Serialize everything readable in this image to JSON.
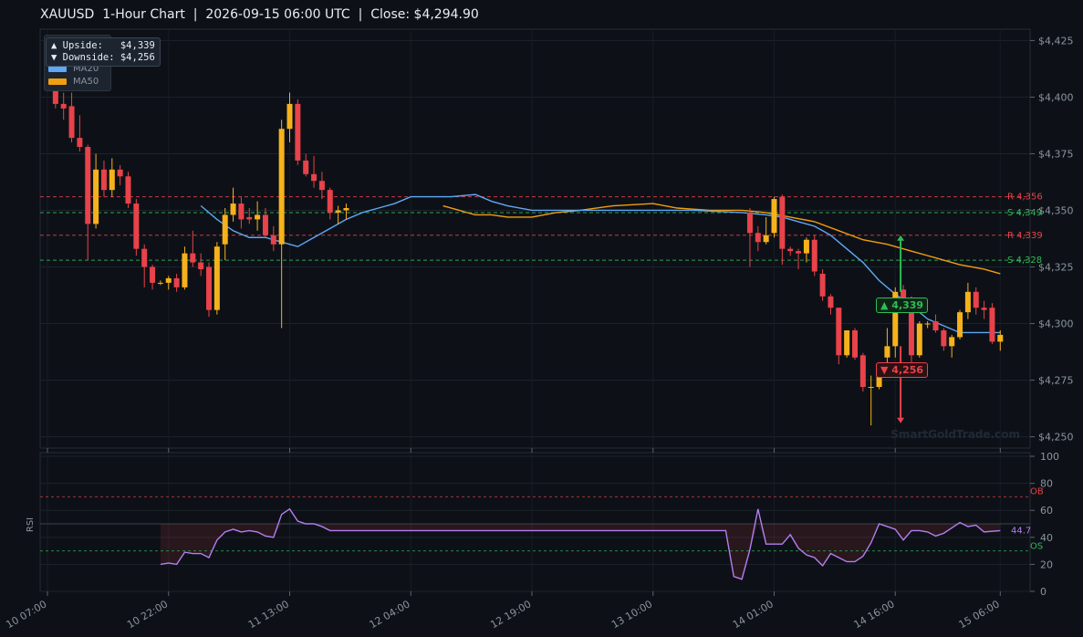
{
  "title": "XAUUSD  1-Hour Chart  |  2026-09-15 06:00 UTC  |  Close: $4,294.90",
  "annotation": {
    "upside": "▲ Upside:   $4,339",
    "downside": "▼ Downside: $4,256"
  },
  "watermark": "SmartGoldTrade.com",
  "colors": {
    "background": "#0d1117",
    "bull": "#f6b21b",
    "bear": "#e8424a",
    "ma20": "#5fa8f5",
    "ma50": "#f29d12",
    "resistance": "#e8424a",
    "support": "#2ebc56",
    "rsi": "#b47ef0"
  },
  "chart_data": [
    {
      "type": "candlestick",
      "ylim": [
        4245,
        4430
      ],
      "y_ticks": [
        "$4,250",
        "$4,275",
        "$4,300",
        "$4,325",
        "$4,350",
        "$4,375",
        "$4,400",
        "$4,425"
      ],
      "y_tick_values": [
        4250,
        4275,
        4300,
        4325,
        4350,
        4375,
        4400,
        4425
      ],
      "x_ticks": [
        "10 07:00",
        "10 22:00",
        "11 13:00",
        "12 04:00",
        "12 19:00",
        "13 10:00",
        "14 01:00",
        "14 16:00",
        "15 06:00"
      ],
      "legend": [
        {
          "name": "MA20",
          "color": "#5fa8f5"
        },
        {
          "name": "MA50",
          "color": "#f29d12"
        }
      ],
      "levels": [
        {
          "label": "R 4,356",
          "value": 4356,
          "kind": "resistance"
        },
        {
          "label": "S 4,349",
          "value": 4349,
          "kind": "support"
        },
        {
          "label": "R 4,339",
          "value": 4339,
          "kind": "resistance"
        },
        {
          "label": "S 4,328",
          "value": 4328,
          "kind": "support"
        }
      ],
      "callouts": [
        {
          "label": "▲ 4,339",
          "value": 4339,
          "kind": "up"
        },
        {
          "label": "▼ 4,256",
          "value": 4256,
          "kind": "down"
        }
      ],
      "candles": [
        {
          "i": 0,
          "o": 4415,
          "h": 4425,
          "l": 4404,
          "c": 4409
        },
        {
          "i": 1,
          "o": 4409,
          "h": 4413,
          "l": 4395,
          "c": 4397
        },
        {
          "i": 2,
          "o": 4397,
          "h": 4402,
          "l": 4390,
          "c": 4395
        },
        {
          "i": 3,
          "o": 4396,
          "h": 4402,
          "l": 4380,
          "c": 4382
        },
        {
          "i": 4,
          "o": 4382,
          "h": 4392,
          "l": 4376,
          "c": 4378
        },
        {
          "i": 5,
          "o": 4378,
          "h": 4379,
          "l": 4328,
          "c": 4344
        },
        {
          "i": 6,
          "o": 4344,
          "h": 4375,
          "l": 4342,
          "c": 4368
        },
        {
          "i": 7,
          "o": 4368,
          "h": 4372,
          "l": 4356,
          "c": 4359
        },
        {
          "i": 8,
          "o": 4359,
          "h": 4373,
          "l": 4356,
          "c": 4368
        },
        {
          "i": 9,
          "o": 4368,
          "h": 4370,
          "l": 4361,
          "c": 4365
        },
        {
          "i": 10,
          "o": 4365,
          "h": 4367,
          "l": 4351,
          "c": 4353
        },
        {
          "i": 11,
          "o": 4353,
          "h": 4355,
          "l": 4330,
          "c": 4333
        },
        {
          "i": 12,
          "o": 4333,
          "h": 4335,
          "l": 4316,
          "c": 4325
        },
        {
          "i": 13,
          "o": 4325,
          "h": 4326,
          "l": 4315,
          "c": 4318
        },
        {
          "i": 14,
          "o": 4318,
          "h": 4319,
          "l": 4317,
          "c": 4318
        },
        {
          "i": 15,
          "o": 4318,
          "h": 4321,
          "l": 4315,
          "c": 4320
        },
        {
          "i": 16,
          "o": 4320,
          "h": 4322,
          "l": 4314,
          "c": 4316
        },
        {
          "i": 17,
          "o": 4316,
          "h": 4334,
          "l": 4315,
          "c": 4331
        },
        {
          "i": 18,
          "o": 4331,
          "h": 4341,
          "l": 4325,
          "c": 4327
        },
        {
          "i": 19,
          "o": 4327,
          "h": 4331,
          "l": 4321,
          "c": 4324
        },
        {
          "i": 20,
          "o": 4325,
          "h": 4327,
          "l": 4303,
          "c": 4306
        },
        {
          "i": 21,
          "o": 4306,
          "h": 4336,
          "l": 4304,
          "c": 4334
        },
        {
          "i": 22,
          "o": 4335,
          "h": 4351,
          "l": 4328,
          "c": 4348
        },
        {
          "i": 23,
          "o": 4348,
          "h": 4360,
          "l": 4345,
          "c": 4353
        },
        {
          "i": 24,
          "o": 4353,
          "h": 4356,
          "l": 4342,
          "c": 4346
        },
        {
          "i": 25,
          "o": 4347,
          "h": 4351,
          "l": 4344,
          "c": 4346
        },
        {
          "i": 26,
          "o": 4346,
          "h": 4354,
          "l": 4341,
          "c": 4348
        },
        {
          "i": 27,
          "o": 4348,
          "h": 4351,
          "l": 4338,
          "c": 4339
        },
        {
          "i": 28,
          "o": 4339,
          "h": 4343,
          "l": 4332,
          "c": 4335
        },
        {
          "i": 29,
          "o": 4335,
          "h": 4390,
          "l": 4298,
          "c": 4386
        },
        {
          "i": 30,
          "o": 4386,
          "h": 4402,
          "l": 4380,
          "c": 4397
        },
        {
          "i": 31,
          "o": 4397,
          "h": 4399,
          "l": 4370,
          "c": 4372
        },
        {
          "i": 32,
          "o": 4372,
          "h": 4375,
          "l": 4365,
          "c": 4366
        },
        {
          "i": 33,
          "o": 4366,
          "h": 4374,
          "l": 4360,
          "c": 4363
        },
        {
          "i": 34,
          "o": 4363,
          "h": 4367,
          "l": 4355,
          "c": 4359
        },
        {
          "i": 35,
          "o": 4359,
          "h": 4360,
          "l": 4346,
          "c": 4349
        },
        {
          "i": 36,
          "o": 4349,
          "h": 4352,
          "l": 4344,
          "c": 4350
        },
        {
          "i": 37,
          "o": 4350,
          "h": 4353,
          "l": 4346,
          "c": 4351
        },
        {
          "i": 87,
          "o": 4349,
          "h": 4351,
          "l": 4325,
          "c": 4340
        },
        {
          "i": 88,
          "o": 4340,
          "h": 4343,
          "l": 4332,
          "c": 4336
        },
        {
          "i": 89,
          "o": 4336,
          "h": 4347,
          "l": 4335,
          "c": 4339
        },
        {
          "i": 90,
          "o": 4340,
          "h": 4356,
          "l": 4338,
          "c": 4355
        },
        {
          "i": 91,
          "o": 4356,
          "h": 4357,
          "l": 4326,
          "c": 4333
        },
        {
          "i": 92,
          "o": 4333,
          "h": 4334,
          "l": 4330,
          "c": 4332
        },
        {
          "i": 93,
          "o": 4332,
          "h": 4333,
          "l": 4324,
          "c": 4331
        },
        {
          "i": 94,
          "o": 4331,
          "h": 4338,
          "l": 4327,
          "c": 4337
        },
        {
          "i": 95,
          "o": 4337,
          "h": 4339,
          "l": 4321,
          "c": 4323
        },
        {
          "i": 96,
          "o": 4322,
          "h": 4324,
          "l": 4310,
          "c": 4312
        },
        {
          "i": 97,
          "o": 4312,
          "h": 4313,
          "l": 4304,
          "c": 4307
        },
        {
          "i": 98,
          "o": 4307,
          "h": 4307,
          "l": 4282,
          "c": 4286
        },
        {
          "i": 99,
          "o": 4286,
          "h": 4297,
          "l": 4285,
          "c": 4297
        },
        {
          "i": 100,
          "o": 4297,
          "h": 4298,
          "l": 4284,
          "c": 4285
        },
        {
          "i": 101,
          "o": 4286,
          "h": 4287,
          "l": 4270,
          "c": 4272
        },
        {
          "i": 102,
          "o": 4272,
          "h": 4277,
          "l": 4255,
          "c": 4272
        },
        {
          "i": 103,
          "o": 4272,
          "h": 4280,
          "l": 4271,
          "c": 4277
        },
        {
          "i": 104,
          "o": 4285,
          "h": 4298,
          "l": 4281,
          "c": 4290
        },
        {
          "i": 105,
          "o": 4290,
          "h": 4316,
          "l": 4285,
          "c": 4314
        },
        {
          "i": 106,
          "o": 4315,
          "h": 4317,
          "l": 4305,
          "c": 4308
        },
        {
          "i": 107,
          "o": 4308,
          "h": 4312,
          "l": 4283,
          "c": 4286
        },
        {
          "i": 108,
          "o": 4286,
          "h": 4301,
          "l": 4285,
          "c": 4300
        },
        {
          "i": 109,
          "o": 4300,
          "h": 4301,
          "l": 4298,
          "c": 4300
        },
        {
          "i": 110,
          "o": 4301,
          "h": 4304,
          "l": 4296,
          "c": 4297
        },
        {
          "i": 111,
          "o": 4297,
          "h": 4298,
          "l": 4288,
          "c": 4290
        },
        {
          "i": 112,
          "o": 4290,
          "h": 4295,
          "l": 4285,
          "c": 4294
        },
        {
          "i": 113,
          "o": 4294,
          "h": 4306,
          "l": 4293,
          "c": 4305
        },
        {
          "i": 114,
          "o": 4305,
          "h": 4318,
          "l": 4302,
          "c": 4314
        },
        {
          "i": 115,
          "o": 4314,
          "h": 4316,
          "l": 4304,
          "c": 4307
        },
        {
          "i": 116,
          "o": 4307,
          "h": 4310,
          "l": 4302,
          "c": 4306
        },
        {
          "i": 117,
          "o": 4307,
          "h": 4309,
          "l": 4291,
          "c": 4292
        },
        {
          "i": 118,
          "o": 4292,
          "h": 4297,
          "l": 4288,
          "c": 4295
        }
      ],
      "ma20": [
        [
          19,
          4352
        ],
        [
          21,
          4346
        ],
        [
          23,
          4341
        ],
        [
          25,
          4338
        ],
        [
          27,
          4338
        ],
        [
          29,
          4336
        ],
        [
          31,
          4334
        ],
        [
          33,
          4338
        ],
        [
          35,
          4342
        ],
        [
          37,
          4346
        ],
        [
          39,
          4349
        ],
        [
          41,
          4351
        ],
        [
          43,
          4353
        ],
        [
          45,
          4356
        ],
        [
          47,
          4356
        ],
        [
          50,
          4356
        ],
        [
          53,
          4357
        ],
        [
          55,
          4354
        ],
        [
          57,
          4352
        ],
        [
          60,
          4350
        ],
        [
          70,
          4350
        ],
        [
          80,
          4350
        ],
        [
          86,
          4349
        ],
        [
          89,
          4348
        ],
        [
          91,
          4347
        ],
        [
          93,
          4345
        ],
        [
          95,
          4343
        ],
        [
          97,
          4339
        ],
        [
          99,
          4333
        ],
        [
          101,
          4327
        ],
        [
          103,
          4319
        ],
        [
          105,
          4313
        ],
        [
          107,
          4308
        ],
        [
          109,
          4302
        ],
        [
          111,
          4299
        ],
        [
          113,
          4296
        ],
        [
          115,
          4296
        ],
        [
          118,
          4296
        ]
      ],
      "ma50": [
        [
          49,
          4352
        ],
        [
          51,
          4350
        ],
        [
          53,
          4348
        ],
        [
          55,
          4348
        ],
        [
          57,
          4347
        ],
        [
          60,
          4347
        ],
        [
          63,
          4349
        ],
        [
          66,
          4350
        ],
        [
          70,
          4352
        ],
        [
          75,
          4353
        ],
        [
          78,
          4351
        ],
        [
          82,
          4350
        ],
        [
          86,
          4350
        ],
        [
          89,
          4349
        ],
        [
          92,
          4347
        ],
        [
          95,
          4345
        ],
        [
          98,
          4341
        ],
        [
          101,
          4337
        ],
        [
          104,
          4335
        ],
        [
          107,
          4332
        ],
        [
          110,
          4329
        ],
        [
          113,
          4326
        ],
        [
          116,
          4324
        ],
        [
          118,
          4322
        ]
      ]
    },
    {
      "type": "line",
      "ylabel": "RSI",
      "ylim": [
        0,
        100
      ],
      "y_ticks": [
        "0",
        "20",
        "40",
        "60",
        "80",
        "100"
      ],
      "y_tick_values": [
        0,
        20,
        40,
        60,
        80,
        100
      ],
      "ob": {
        "label": "OB",
        "value": 70
      },
      "os": {
        "label": "OS",
        "value": 30
      },
      "last_label": "44.7",
      "values": [
        [
          14,
          20
        ],
        [
          15,
          21
        ],
        [
          16,
          20
        ],
        [
          17,
          29
        ],
        [
          18,
          28
        ],
        [
          19,
          28
        ],
        [
          20,
          25
        ],
        [
          21,
          38
        ],
        [
          22,
          44
        ],
        [
          23,
          46
        ],
        [
          24,
          44
        ],
        [
          25,
          45
        ],
        [
          26,
          44
        ],
        [
          27,
          41
        ],
        [
          28,
          40
        ],
        [
          29,
          57
        ],
        [
          30,
          61
        ],
        [
          31,
          52
        ],
        [
          32,
          50
        ],
        [
          33,
          50
        ],
        [
          34,
          48
        ],
        [
          35,
          45
        ],
        [
          37,
          45
        ],
        [
          40,
          45
        ],
        [
          50,
          45
        ],
        [
          60,
          45
        ],
        [
          70,
          45
        ],
        [
          80,
          45
        ],
        [
          84,
          45
        ],
        [
          85,
          11
        ],
        [
          86,
          9
        ],
        [
          87,
          31
        ],
        [
          88,
          61
        ],
        [
          89,
          35
        ],
        [
          90,
          35
        ],
        [
          91,
          35
        ],
        [
          92,
          42
        ],
        [
          93,
          32
        ],
        [
          94,
          27
        ],
        [
          95,
          25
        ],
        [
          96,
          19
        ],
        [
          97,
          28
        ],
        [
          98,
          25
        ],
        [
          99,
          22
        ],
        [
          100,
          22
        ],
        [
          101,
          26
        ],
        [
          102,
          36
        ],
        [
          103,
          50
        ],
        [
          104,
          48
        ],
        [
          105,
          46
        ],
        [
          106,
          38
        ],
        [
          107,
          45
        ],
        [
          108,
          45
        ],
        [
          109,
          44
        ],
        [
          110,
          41
        ],
        [
          111,
          43
        ],
        [
          112,
          47
        ],
        [
          113,
          51
        ],
        [
          114,
          48
        ],
        [
          115,
          49
        ],
        [
          116,
          44
        ],
        [
          118,
          45
        ]
      ]
    }
  ]
}
